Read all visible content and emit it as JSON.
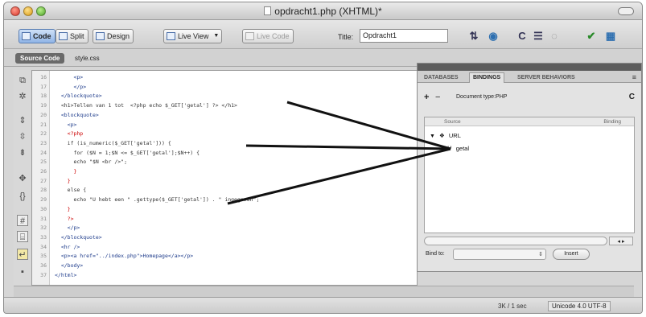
{
  "window": {
    "title": "opdracht1.php (XHTML)*"
  },
  "toolbar": {
    "code_label": "Code",
    "split_label": "Split",
    "design_label": "Design",
    "live_view_label": "Live View",
    "live_code_label": "Live Code",
    "title_label": "Title:",
    "title_value": "Opdracht1",
    "icons": [
      "file-management-icon",
      "globe-icon",
      "refresh-icon",
      "view-options-icon",
      "visual-aids-icon",
      "check-page-icon",
      "browser-compat-icon"
    ]
  },
  "document_tabs": {
    "source_code": "Source Code",
    "css_file": "style.css"
  },
  "left_toolbar_icons": [
    "open-documents-icon",
    "show-code-navigator-icon",
    "collapse-full-tag-icon",
    "collapse-selection-icon",
    "expand-all-icon",
    "select-parent-tag-icon",
    "balance-braces-icon",
    "line-numbers-icon",
    "highlight-invalid-code-icon",
    "word-wrap-icon",
    "apply-comment-icon"
  ],
  "code": {
    "lines": [
      {
        "n": "16",
        "text": "      <p>"
      },
      {
        "n": "17",
        "text": "      </p>"
      },
      {
        "n": "18",
        "text": "  </blockquote>"
      },
      {
        "n": "19",
        "text": "  <h1>Tellen van 1 tot  <?php echo $_GET['getal'] ?> </h1>"
      },
      {
        "n": "20",
        "text": "  <blockquote>"
      },
      {
        "n": "21",
        "text": "    <p>"
      },
      {
        "n": "22",
        "text": "    <?php"
      },
      {
        "n": "23",
        "text": "    if (is_numeric($_GET['getal'])) {"
      },
      {
        "n": "24",
        "text": "      for ($N = 1;$N <= $_GET['getal'];$N++) {"
      },
      {
        "n": "25",
        "text": "      echo \"$N <br />\";"
      },
      {
        "n": "26",
        "text": "      }"
      },
      {
        "n": "27",
        "text": "    }"
      },
      {
        "n": "28",
        "text": "    else {"
      },
      {
        "n": "29",
        "text": "      echo \"U hebt een \" .gettype($_GET['getal']) . \" ingegeven\";"
      },
      {
        "n": "30",
        "text": "    }"
      },
      {
        "n": "31",
        "text": "    ?>"
      },
      {
        "n": "32",
        "text": "    </p>"
      },
      {
        "n": "33",
        "text": "  </blockquote>"
      },
      {
        "n": "34",
        "text": "  <hr />"
      },
      {
        "n": "35",
        "text": "  <p><a href=\"../index.php\">Homepage</a></p>"
      },
      {
        "n": "36",
        "text": "  </body>"
      },
      {
        "n": "37",
        "text": "</html>"
      }
    ]
  },
  "bindings_panel": {
    "tabs": [
      "DATABASES",
      "BINDINGS",
      "SERVER BEHAVIORS"
    ],
    "active_tab": "BINDINGS",
    "document_type": "Document type:PHP",
    "tree_headers": {
      "source": "Source",
      "binding": "Binding"
    },
    "nodes": [
      {
        "label": "URL",
        "level": 0,
        "icon": "url-icon"
      },
      {
        "label": "getal",
        "level": 1,
        "icon": "variable-icon"
      }
    ],
    "bind_to_label": "Bind to:",
    "insert_label": "Insert"
  },
  "status": {
    "size": "3K / 1 sec",
    "encoding": "Unicode 4.0 UTF-8"
  },
  "colors": {
    "tag": "#1c3a8a",
    "php": "#cc0000",
    "line_number": "#8a8a8a"
  }
}
